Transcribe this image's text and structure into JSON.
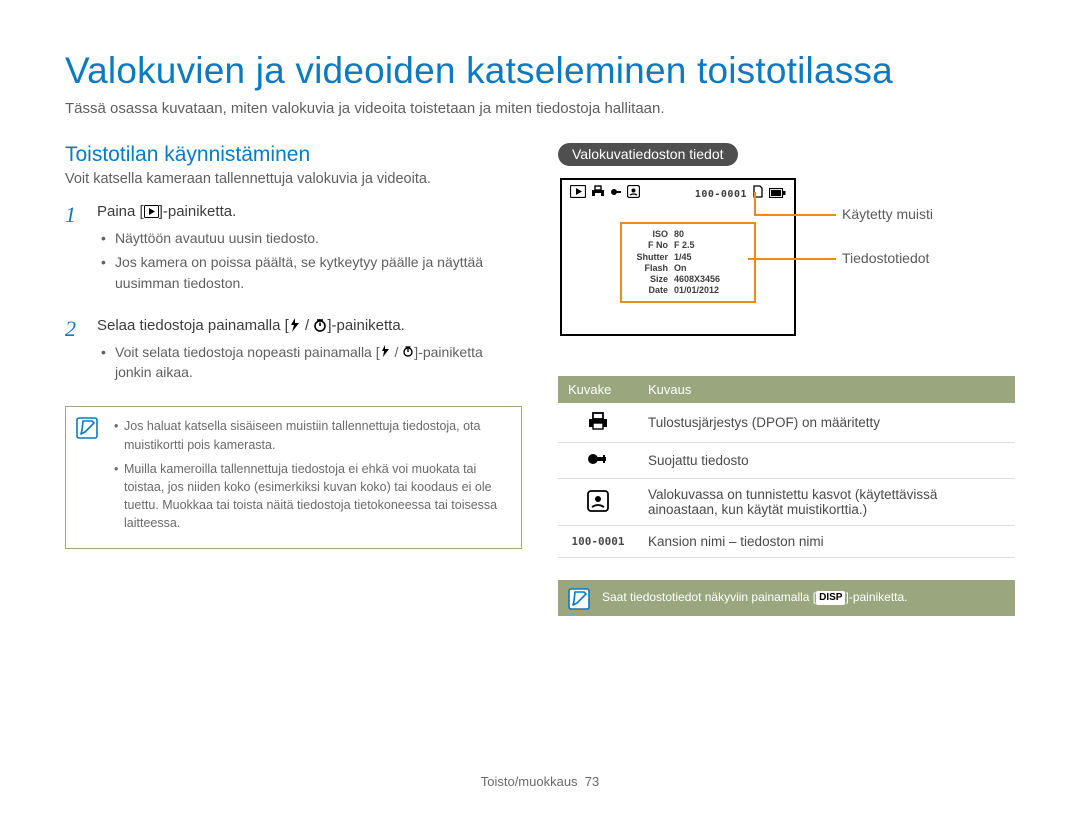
{
  "title": "Valokuvien ja videoiden katseleminen toistotilassa",
  "subtitle": "Tässä osassa kuvataan, miten valokuvia ja videoita toistetaan ja miten tiedostoja hallitaan.",
  "left": {
    "heading": "Toistotilan käynnistäminen",
    "desc": "Voit katsella kameraan tallennettuja valokuvia ja videoita.",
    "step1": {
      "num": "1",
      "text_a": "Paina [",
      "text_b": "]-painiketta.",
      "bullets": [
        "Näyttöön avautuu uusin tiedosto.",
        "Jos kamera on poissa päältä, se kytkeytyy päälle ja näyttää uusimman tiedoston."
      ]
    },
    "step2": {
      "num": "2",
      "text_a": "Selaa tiedostoja painamalla [",
      "text_b": "]-painiketta.",
      "bullets_a": "Voit selata tiedostoja nopeasti painamalla [",
      "bullets_b": "]-painiketta jonkin aikaa."
    },
    "notes": [
      "Jos haluat katsella sisäiseen muistiin tallennettuja tiedostoja, ota muistikortti pois kamerasta.",
      "Muilla kameroilla tallennettuja tiedostoja ei ehkä voi muokata tai toistaa, jos niiden koko (esimerkiksi kuvan koko) tai koodaus ei ole tuettu. Muokkaa tai toista näitä tiedostoja tietokoneessa tai toisessa laitteessa."
    ]
  },
  "right": {
    "pill": "Valokuvatiedoston tiedot",
    "lcd_folder": "100-0001",
    "info": {
      "iso_k": "ISO",
      "iso_v": "80",
      "fno_k": "F No",
      "fno_v": "F 2.5",
      "sh_k": "Shutter",
      "sh_v": "1/45",
      "fl_k": "Flash",
      "fl_v": "On",
      "sz_k": "Size",
      "sz_v": "4608X3456",
      "dt_k": "Date",
      "dt_v": "01/01/2012"
    },
    "call_memory": "Käytetty muisti",
    "call_fileinfo": "Tiedostotiedot",
    "table": {
      "head_icon": "Kuvake",
      "head_desc": "Kuvaus",
      "rows": {
        "dpof": "Tulostusjärjestys (DPOF) on määritetty",
        "lock": "Suojattu tiedosto",
        "face": "Valokuvassa on tunnistettu kasvot (käytettävissä ainoastaan, kun käytät muistikorttia.)",
        "folder_code": "100-0001",
        "folder": "Kansion nimi – tiedoston nimi"
      }
    },
    "note_strip_a": "Saat tiedostotiedot näkyviin painamalla [",
    "note_strip_disp": "DISP",
    "note_strip_b": "]-painiketta."
  },
  "footer": {
    "section": "Toisto/muokkaus",
    "page": "73"
  }
}
